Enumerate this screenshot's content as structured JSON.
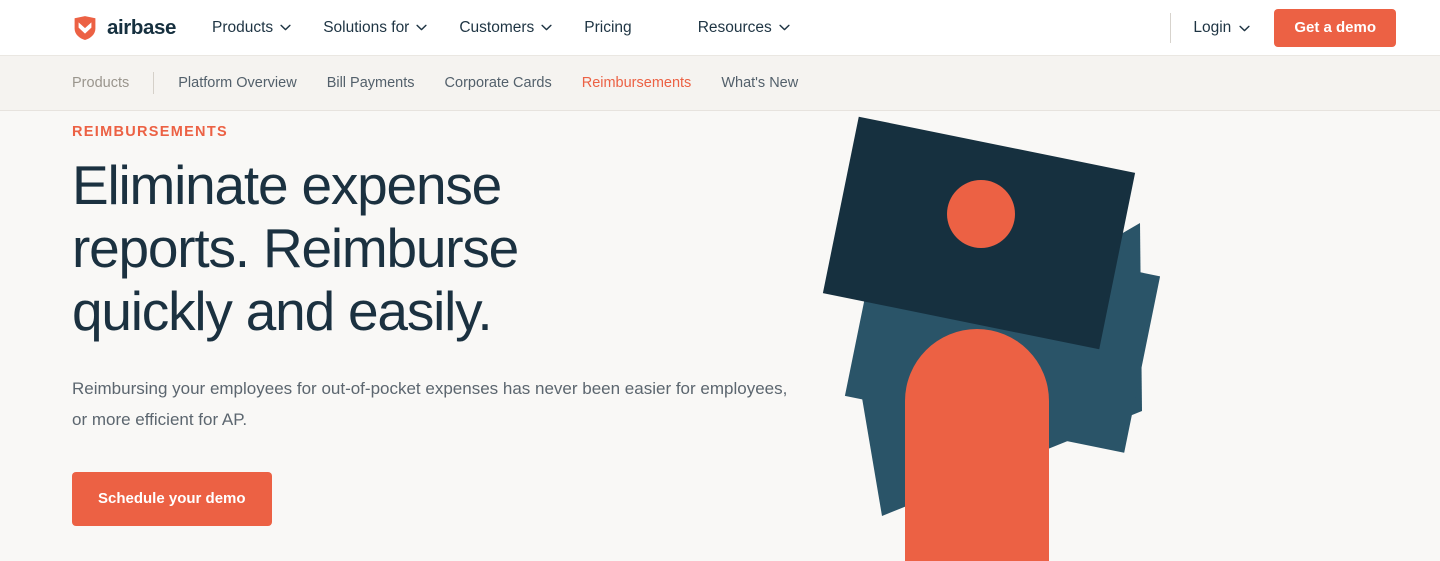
{
  "brand": {
    "name": "airbase",
    "logo_icon": "airbase-chevron-shield-icon",
    "accent": "#EC6144"
  },
  "topnav": {
    "items": [
      {
        "label": "Products",
        "has_dropdown": true,
        "icon": "chevron-down-icon"
      },
      {
        "label": "Solutions for",
        "has_dropdown": true,
        "icon": "chevron-down-icon"
      },
      {
        "label": "Customers",
        "has_dropdown": true,
        "icon": "chevron-down-icon"
      },
      {
        "label": "Pricing",
        "has_dropdown": false
      },
      {
        "label": "Resources",
        "has_dropdown": true,
        "icon": "chevron-down-icon"
      }
    ],
    "login": {
      "label": "Login",
      "icon": "chevron-down-icon"
    },
    "cta": {
      "label": "Get a demo"
    }
  },
  "subnav": {
    "section_label": "Products",
    "links": [
      {
        "label": "Platform Overview",
        "active": false
      },
      {
        "label": "Bill Payments",
        "active": false
      },
      {
        "label": "Corporate Cards",
        "active": false
      },
      {
        "label": "Reimbursements",
        "active": true
      },
      {
        "label": "What's New",
        "active": false
      }
    ]
  },
  "hero": {
    "eyebrow": "REIMBURSEMENTS",
    "title": "Eliminate expense reports. Reimburse quickly and easily.",
    "subtitle": "Reimbursing your employees for out-of-pocket expenses has never been easier for employees, or more efficient for AP.",
    "cta": {
      "label": "Schedule your demo"
    },
    "illustration": {
      "name": "abstract-cards-illustration",
      "shapes": [
        {
          "name": "teal-card",
          "color": "#2A5468"
        },
        {
          "name": "navy-card",
          "color": "#16303F"
        },
        {
          "name": "orange-circle",
          "color": "#EC6144"
        },
        {
          "name": "orange-arch",
          "color": "#EC6144"
        }
      ]
    }
  },
  "colors": {
    "accent_orange": "#EC6144",
    "dark_navy": "#16303F",
    "teal": "#2A5468",
    "page_bg": "#F9F8F6",
    "subnav_bg": "#F5F3F0",
    "topnav_bg": "#FFFFFF"
  }
}
